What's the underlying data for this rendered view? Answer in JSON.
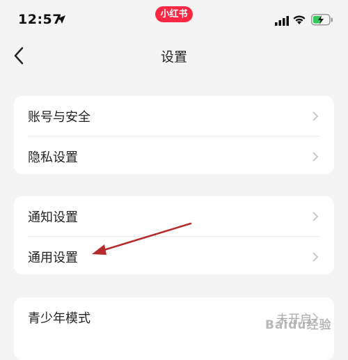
{
  "status_bar": {
    "time": "12:57",
    "app_badge": "小红书"
  },
  "nav": {
    "title": "设置"
  },
  "sections": [
    {
      "items": [
        {
          "label": "账号与安全"
        },
        {
          "label": "隐私设置"
        }
      ]
    },
    {
      "items": [
        {
          "label": "通知设置"
        },
        {
          "label": "通用设置"
        }
      ]
    },
    {
      "items": [
        {
          "label": "青少年模式",
          "value": "未开启"
        }
      ]
    }
  ],
  "watermark": "Baidu经验",
  "colors": {
    "background": "#f4f4f4",
    "card": "#ffffff",
    "badge": "#ff2741",
    "annotation_arrow": "#b52a2a"
  }
}
